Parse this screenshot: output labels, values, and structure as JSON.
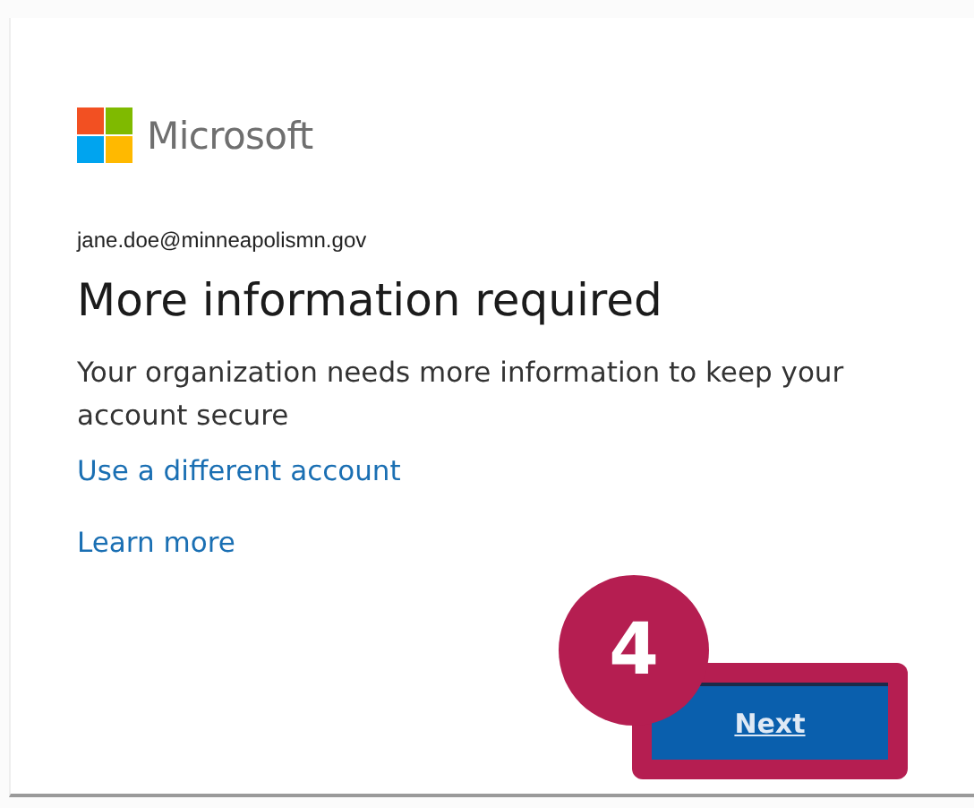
{
  "brand": {
    "name": "Microsoft"
  },
  "email": "jane.doe@minneapolismn.gov",
  "title": "More information required",
  "message": "Your organization needs more information to keep your account secure",
  "links": [
    "Use a different account",
    "Learn more"
  ],
  "step_badge": "4",
  "next_button": {
    "label": "Next",
    "highlighted": true
  }
}
